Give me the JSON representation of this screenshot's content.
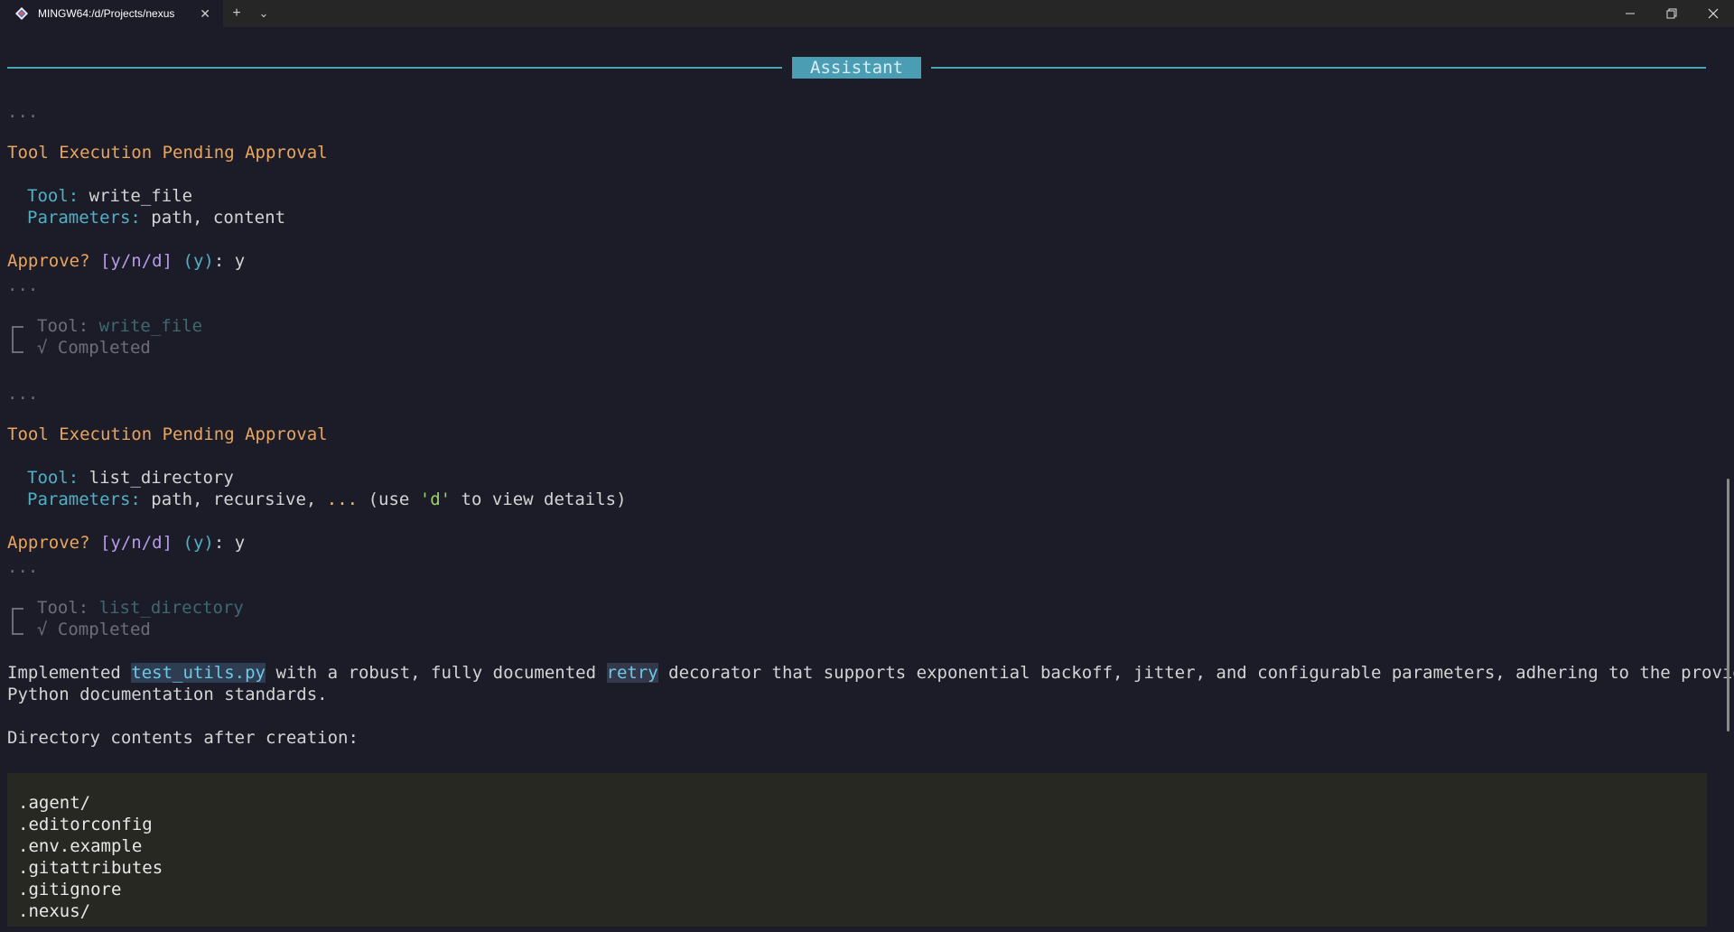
{
  "window": {
    "tab_title": "MINGW64:/d/Projects/nexus",
    "new_tab": "+",
    "dropdown": "⌄",
    "minimize": "—",
    "maximize": "❐",
    "close": "✕"
  },
  "banner": "Assistant",
  "blocks": {
    "ellipsis": "...",
    "pending_title": "Tool Execution Pending Approval",
    "tool_label": "Tool:",
    "params_label": "Parameters:",
    "approve_prompt": "Approve?",
    "approve_options": "[y/n/d]",
    "approve_default": "(y)",
    "approve_colon": ":",
    "approve_answer": "y",
    "completed": "√ Completed",
    "tool1_name": "write_file",
    "tool1_params": "path, content",
    "tool2_name": "list_directory",
    "tool2_params": "path, recursive,",
    "tool2_more": "...",
    "tool2_hint_pre": "(use ",
    "tool2_hint_key": "'d'",
    "tool2_hint_post": " to view details)"
  },
  "summary": {
    "part1": "Implemented ",
    "file": "test_utils.py",
    "part2": " with a robust, fully documented ",
    "decorator": "retry",
    "part3": " decorator that supports exponential backoff, jitter, and configurable parameters, adhering to the provided",
    "line2": "Python documentation standards.",
    "dir_heading": "Directory contents after creation:"
  },
  "directory": [
    ".agent/",
    ".editorconfig",
    ".env.example",
    ".gitattributes",
    ".gitignore",
    ".nexus/"
  ]
}
